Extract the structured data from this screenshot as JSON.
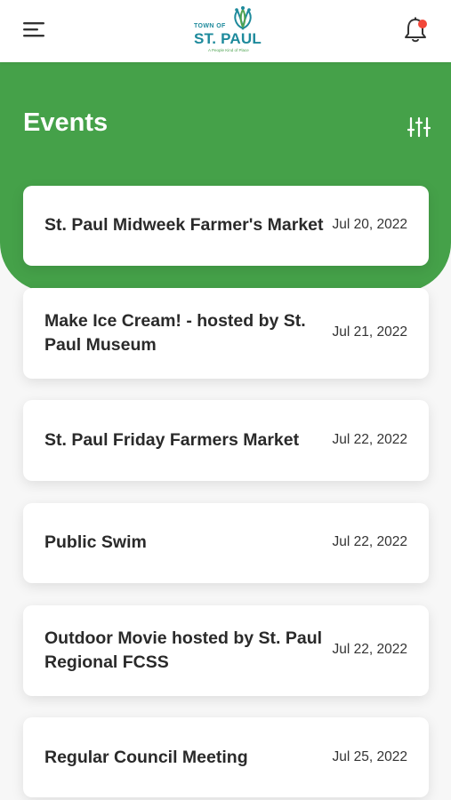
{
  "app": {
    "logo": {
      "town_of": "TOWN OF",
      "name": "ST. PAUL",
      "tagline": "A People Kind of Place"
    }
  },
  "header": {
    "title": "Events",
    "menu_icon": "hamburger-menu-icon",
    "notification_icon": "bell-icon",
    "filter_icon": "sliders-filter-icon"
  },
  "colors": {
    "brand_green": "#45a149",
    "logo_teal": "#1e8a9c",
    "notification_dot": "#f2483a"
  },
  "events": [
    {
      "title": "St. Paul Midweek Farmer's Market",
      "date": "Jul 20, 2022"
    },
    {
      "title": "Make Ice Cream! - hosted by St. Paul Museum",
      "date": "Jul 21, 2022"
    },
    {
      "title": "St. Paul Friday Farmers Market",
      "date": "Jul 22, 2022"
    },
    {
      "title": "Public Swim",
      "date": "Jul 22, 2022"
    },
    {
      "title": "Outdoor Movie hosted by St. Paul Regional FCSS",
      "date": "Jul 22, 2022"
    },
    {
      "title": "Regular Council Meeting",
      "date": "Jul 25, 2022"
    }
  ]
}
